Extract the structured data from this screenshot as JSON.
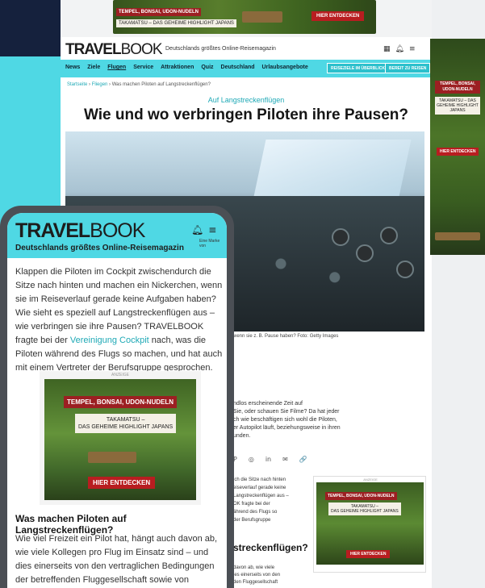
{
  "desktop": {
    "top_ad": {
      "tag": "TEMPEL, BONSAI, UDON-NUDELN",
      "sub": "TAKAMATSU – DAS GEHEIME HIGHLIGHT JAPANS",
      "cta": "HIER ENTDECKEN"
    },
    "brand": {
      "bold": "TRAVEL",
      "light": "BOOK",
      "tagline": "Deutschlands größtes Online-Reisemagazin"
    },
    "icons": [
      "stern-logo-icon",
      "bell-icon",
      "menu-icon"
    ],
    "nav": [
      "News",
      "Ziele",
      "Flugen",
      "Service",
      "Attraktionen",
      "Quiz",
      "Deutschland",
      "Urlaubsangebote"
    ],
    "nav_buttons": [
      "REISEZIELE IM ÜBERBLICK",
      "BEREIT ZU REISEN"
    ],
    "breadcrumb": {
      "home": "Startseite",
      "section": "Fliegen",
      "current": "Was machen Piloten auf Langstreckenflügen?"
    },
    "kicker": "Auf Langstreckenflügen",
    "headline": "Wie und wo verbringen Piloten ihre Pausen?",
    "caption": "wenn sie z. B. Pause haben? Foto: Getty Images",
    "body_fragment": "ndlos erscheinende Zeit auf\n Sie, oder schauen Sie Filme? Da hat jeder\nch wie beschäftigen sich wohl die Piloten,\ner Autopilot läuft, beziehungsweise in ihren\nunden.",
    "share_icons": [
      "P",
      "◎",
      "in",
      "✉",
      "🔗"
    ],
    "fragment2": "ich die Sitze nach hinten\neiseverlauf gerade keine\nLangstreckenflügen aus –\nOK fragte bei der\nährend des Flugs so\nder Berufsgruppe",
    "h2_fragment": "streckenflügen?",
    "fragment3": "davon ab, wie viele\nies einerseits von den\nden Fluggesellschaft",
    "side_ad": {
      "label": "ANZEIGE",
      "tag": "TEMPEL, BONSAI, UDON-NUDELN",
      "sub": "TAKAMATSU –\nDAS GEHEIME HIGHLIGHT JAPANS",
      "cta": "HIER ENTDECKEN"
    }
  },
  "skyscraper": {
    "tag": "TEMPEL, BONSAI, UDON-NUDELN",
    "sub": "TAKAMATSU – DAS GEHEIME HIGHLIGHT JAPANS",
    "cta": "HIER ENTDECKEN"
  },
  "mobile": {
    "brand": {
      "bold": "TRAVEL",
      "light": "BOOK",
      "tagline": "Deutschlands größtes Online-Reisemagazin"
    },
    "stern_label": "Eine Marke von",
    "intro_before_link": "Klappen die Piloten im Cockpit zwischendurch die Sitze nach hinten und machen ein Nickerchen, wenn sie im Reiseverlauf gerade keine Aufgaben haben? Wie sieht es speziell auf Langstreckenflügen aus – wie verbringen sie ihre Pausen? TRAVELBOOK fragte bei der ",
    "intro_link": "Vereinigung Cockpit",
    "intro_after_link": " nach, was die Piloten während des Flugs so machen, und hat auch mit einem Vertreter der Berufsgruppe gesprochen.",
    "ad": {
      "label": "ANZEIGE",
      "tag": "TEMPEL, BONSAI, UDON-NUDELN",
      "sub": "TAKAMATSU –\nDAS GEHEIME HIGHLIGHT JAPANS",
      "cta": "HIER ENTDECKEN"
    },
    "h2": "Was machen Piloten auf Langstreckenflügen?",
    "para2": "Wie viel Freizeit ein Pilot hat, hängt auch davon ab, wie viele Kollegen pro Flug im Einsatz sind – und dies einerseits von den vertraglichen Bedingungen der betreffenden Fluggesellschaft sowie von Vorgaben der Luftfahrtbehörde. Das erklärt TRAVELBOOK Lars"
  }
}
